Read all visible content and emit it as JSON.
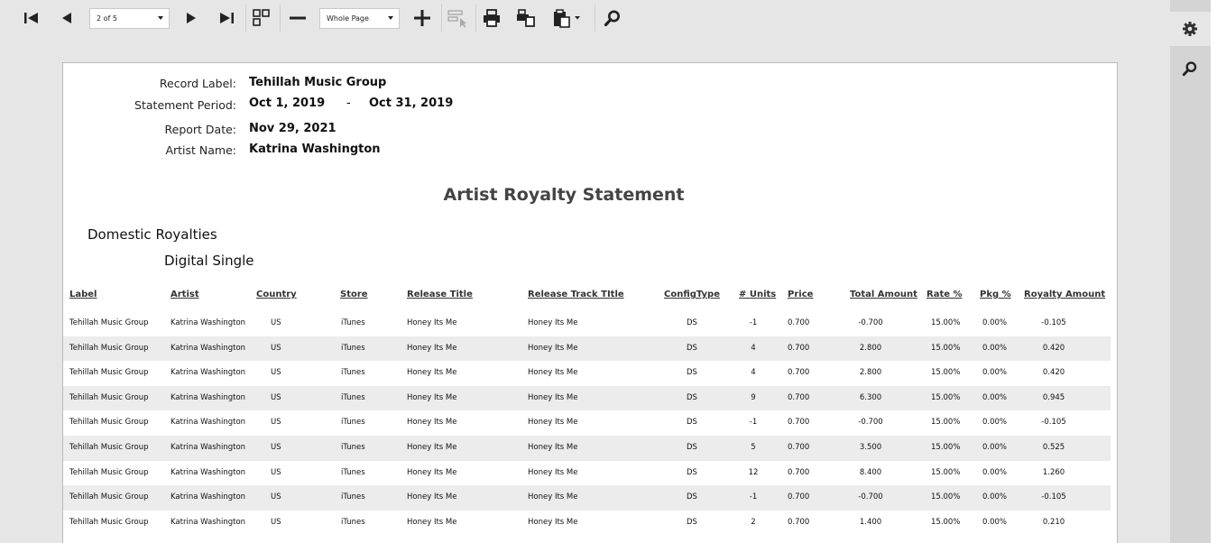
{
  "toolbar": {
    "page_selector": "2 of 5",
    "zoom_selector": "Whole Page",
    "icons": [
      "first-page-icon",
      "previous-page-icon",
      "next-page-icon",
      "last-page-icon",
      "multipage-icon",
      "zoom-out-icon",
      "zoom-in-icon",
      "select-tool-icon",
      "print-icon",
      "print-page-icon",
      "export-icon",
      "search-icon"
    ]
  },
  "sidebar": {
    "icons": [
      "gear-icon",
      "search-icon"
    ]
  },
  "report": {
    "header": {
      "record_label_label": "Record Label:",
      "record_label": "Tehillah Music Group",
      "statement_period_label": "Statement Period:",
      "period_start": "Oct 1, 2019",
      "period_dash": "-",
      "period_end": "Oct 31, 2019",
      "report_date_label": "Report Date:",
      "report_date": "Nov 29, 2021",
      "artist_name_label": "Artist Name:",
      "artist_name": "Katrina Washington"
    },
    "title": "Artist Royalty Statement",
    "section": "Domestic Royalties",
    "subsection": "Digital Single",
    "columns": [
      "Label",
      "Artist",
      "Country",
      "Store",
      "Release Title",
      "Release Track TItle",
      "ConfigType",
      "# Units",
      "Price",
      "Total Amount",
      "Rate %",
      "Pkg %",
      "Royalty Amount"
    ],
    "rows": [
      [
        "Tehillah Music Group",
        "Katrina Washington",
        "US",
        "iTunes",
        "Honey Its Me",
        "Honey Its Me",
        "DS",
        "-1",
        "0.700",
        "-0.700",
        "15.00%",
        "0.00%",
        "-0.105"
      ],
      [
        "Tehillah Music Group",
        "Katrina Washington",
        "US",
        "iTunes",
        "Honey Its Me",
        "Honey Its Me",
        "DS",
        "4",
        "0.700",
        "2.800",
        "15.00%",
        "0.00%",
        "0.420"
      ],
      [
        "Tehillah Music Group",
        "Katrina Washington",
        "US",
        "iTunes",
        "Honey Its Me",
        "Honey Its Me",
        "DS",
        "4",
        "0.700",
        "2.800",
        "15.00%",
        "0.00%",
        "0.420"
      ],
      [
        "Tehillah Music Group",
        "Katrina Washington",
        "US",
        "iTunes",
        "Honey Its Me",
        "Honey Its Me",
        "DS",
        "9",
        "0.700",
        "6.300",
        "15.00%",
        "0.00%",
        "0.945"
      ],
      [
        "Tehillah Music Group",
        "Katrina Washington",
        "US",
        "iTunes",
        "Honey Its Me",
        "Honey Its Me",
        "DS",
        "-1",
        "0.700",
        "-0.700",
        "15.00%",
        "0.00%",
        "-0.105"
      ],
      [
        "Tehillah Music Group",
        "Katrina Washington",
        "US",
        "iTunes",
        "Honey Its Me",
        "Honey Its Me",
        "DS",
        "5",
        "0.700",
        "3.500",
        "15.00%",
        "0.00%",
        "0.525"
      ],
      [
        "Tehillah Music Group",
        "Katrina Washington",
        "US",
        "iTunes",
        "Honey Its Me",
        "Honey Its Me",
        "DS",
        "12",
        "0.700",
        "8.400",
        "15.00%",
        "0.00%",
        "1.260"
      ],
      [
        "Tehillah Music Group",
        "Katrina Washington",
        "US",
        "iTunes",
        "Honey Its Me",
        "Honey Its Me",
        "DS",
        "-1",
        "0.700",
        "-0.700",
        "15.00%",
        "0.00%",
        "-0.105"
      ],
      [
        "Tehillah Music Group",
        "Katrina Washington",
        "US",
        "iTunes",
        "Honey Its Me",
        "Honey Its Me",
        "DS",
        "2",
        "0.700",
        "1.400",
        "15.00%",
        "0.00%",
        "0.210"
      ]
    ]
  }
}
